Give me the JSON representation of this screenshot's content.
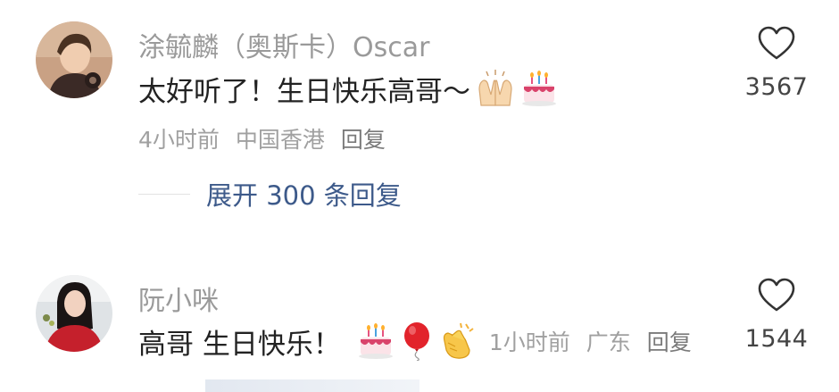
{
  "comments": [
    {
      "username": "涂毓麟（奥斯卡）Oscar",
      "text": "太好听了！生日快乐高哥～",
      "emojis": [
        "raised-hands-emoji",
        "birthday-cake-emoji"
      ],
      "time": "4小时前",
      "location": "中国香港",
      "reply_label": "回复",
      "likes": "3567",
      "expand_label": "展开 300 条回复"
    },
    {
      "username": "阮小咪",
      "text": "高哥 生日快乐！",
      "emojis": [
        "birthday-cake-emoji",
        "balloon-emoji",
        "clapping-hands-emoji"
      ],
      "time": "1小时前",
      "location": "广东",
      "reply_label": "回复",
      "likes": "1544"
    }
  ],
  "icons": {
    "like": "heart-outline-icon"
  },
  "colors": {
    "username": "#9a9a9a",
    "text": "#222222",
    "meta": "#a0a0a0",
    "expand": "#3d5a8a"
  }
}
